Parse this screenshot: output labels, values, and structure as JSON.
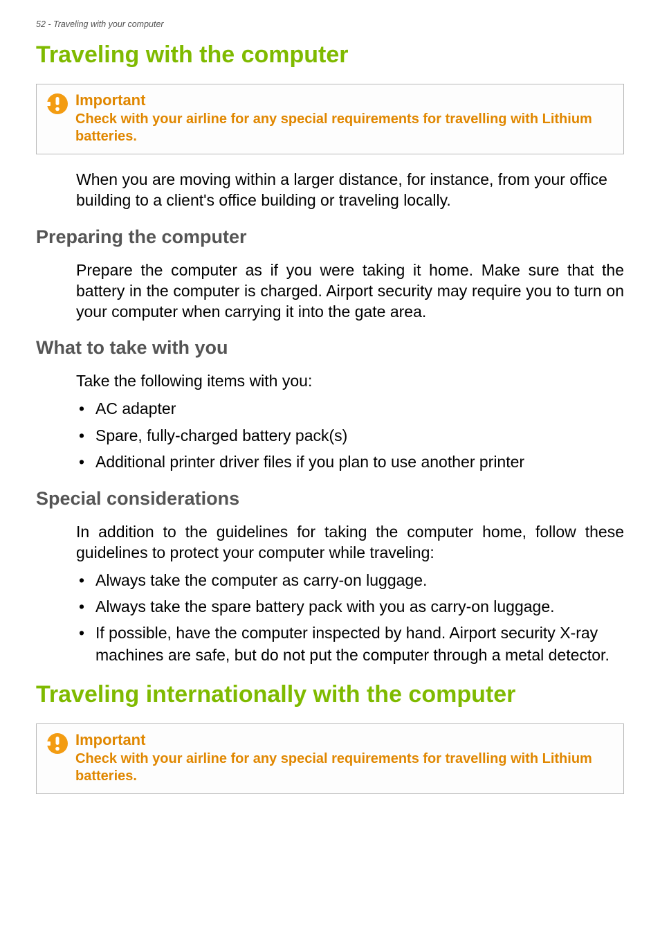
{
  "header": {
    "page_num_and_title": "52 - Traveling with your computer"
  },
  "section1": {
    "title": "Traveling with the computer",
    "callout": {
      "title": "Important",
      "body": "Check with your airline for any special requirements for travelling with Lithium batteries."
    },
    "intro": "When you are moving within a larger distance, for instance, from your office building to a client's office building or traveling locally.",
    "sub1": {
      "heading": "Preparing the computer",
      "body": "Prepare the computer as if you were taking it home. Make sure that the battery in the computer is charged. Airport security may require you to turn on your computer when carrying it into the gate area."
    },
    "sub2": {
      "heading": "What to take with you",
      "lead": "Take the following items with you:",
      "items": [
        "AC adapter",
        "Spare, fully-charged battery pack(s)",
        "Additional printer driver files if you plan to use another printer"
      ]
    },
    "sub3": {
      "heading": "Special considerations",
      "lead": "In addition to the guidelines for taking the computer home, follow these guidelines to protect your computer while traveling:",
      "items": [
        "Always take the computer as carry-on luggage.",
        "Always take the spare battery pack with you as carry-on luggage.",
        "If possible, have the computer inspected by hand. Airport security X-ray machines are safe, but do not put the computer through a metal detector."
      ]
    }
  },
  "section2": {
    "title": "Traveling internationally with the computer",
    "callout": {
      "title": "Important",
      "body": "Check with your airline for any special requirements for travelling with Lithium batteries."
    }
  }
}
